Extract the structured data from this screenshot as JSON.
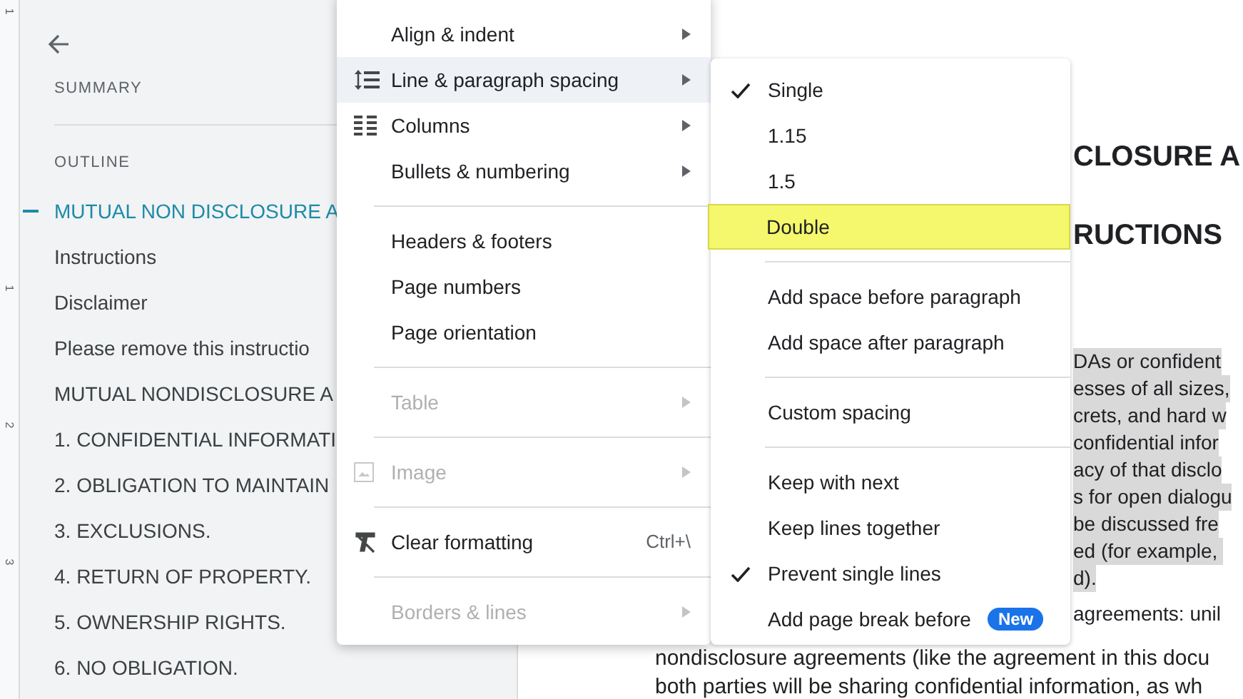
{
  "ruler": {
    "labels": [
      "1",
      "1",
      "2",
      "3"
    ]
  },
  "sidebar": {
    "summary_label": "SUMMARY",
    "outline_label": "OUTLINE",
    "items": [
      {
        "label": "MUTUAL NON DISCLOSURE A",
        "selected": true
      },
      {
        "label": "Instructions",
        "selected": false
      },
      {
        "label": "Disclaimer",
        "selected": false
      },
      {
        "label": "Please remove this instructio",
        "selected": false
      },
      {
        "label": "MUTUAL NONDISCLOSURE A",
        "selected": false
      },
      {
        "label": "1. CONFIDENTIAL INFORMATI",
        "selected": false
      },
      {
        "label": "2. OBLIGATION TO MAINTAIN",
        "selected": false
      },
      {
        "label": "3. EXCLUSIONS.",
        "selected": false
      },
      {
        "label": "4. RETURN OF PROPERTY.",
        "selected": false
      },
      {
        "label": "5. OWNERSHIP RIGHTS.",
        "selected": false
      },
      {
        "label": "6. NO OBLIGATION.",
        "selected": false
      }
    ]
  },
  "document": {
    "headings": [
      "CLOSURE A",
      "RUCTIONS"
    ],
    "highlighted_lines": [
      "DAs or confident",
      "esses of all sizes,",
      "crets, and hard w",
      "confidential infor",
      "acy of that disclo",
      "s for open dialogu",
      "be discussed fre",
      "ed (for example, ",
      "d)."
    ],
    "side_line": "agreements: unil",
    "lines": [
      "nondisclosure agreements (like the agreement in this docu",
      "both parties will be sharing confidential information, as wh"
    ]
  },
  "format_menu": {
    "items": [
      {
        "kind": "item",
        "label": "Align & indent",
        "submenu": true,
        "disabled": false,
        "selected": false
      },
      {
        "kind": "spacing",
        "label": "Line & paragraph spacing",
        "submenu": true,
        "disabled": false,
        "selected": true
      },
      {
        "kind": "columns",
        "label": "Columns",
        "submenu": true,
        "disabled": false,
        "selected": false
      },
      {
        "kind": "item",
        "label": "Bullets & numbering",
        "submenu": true,
        "disabled": false,
        "selected": false
      },
      {
        "kind": "separator"
      },
      {
        "kind": "item",
        "label": "Headers & footers",
        "submenu": false,
        "disabled": false,
        "selected": false
      },
      {
        "kind": "item",
        "label": "Page numbers",
        "submenu": false,
        "disabled": false,
        "selected": false
      },
      {
        "kind": "item",
        "label": "Page orientation",
        "submenu": false,
        "disabled": false,
        "selected": false
      },
      {
        "kind": "separator"
      },
      {
        "kind": "item",
        "label": "Table",
        "submenu": true,
        "disabled": true,
        "selected": false
      },
      {
        "kind": "separator"
      },
      {
        "kind": "image",
        "label": "Image",
        "submenu": true,
        "disabled": true,
        "selected": false
      },
      {
        "kind": "separator"
      },
      {
        "kind": "clear",
        "label": "Clear formatting",
        "submenu": false,
        "disabled": false,
        "selected": false,
        "shortcut": "Ctrl+\\"
      },
      {
        "kind": "separator"
      },
      {
        "kind": "item",
        "label": "Borders & lines",
        "submenu": true,
        "disabled": true,
        "selected": false
      }
    ]
  },
  "spacing_menu": {
    "items": [
      {
        "kind": "item",
        "label": "Single",
        "checked": true,
        "highlighted": false
      },
      {
        "kind": "item",
        "label": "1.15",
        "checked": false,
        "highlighted": false
      },
      {
        "kind": "item",
        "label": "1.5",
        "checked": false,
        "highlighted": false
      },
      {
        "kind": "item",
        "label": "Double",
        "checked": false,
        "highlighted": true
      },
      {
        "kind": "separator"
      },
      {
        "kind": "item",
        "label": "Add space before paragraph",
        "checked": false,
        "highlighted": false
      },
      {
        "kind": "item",
        "label": "Add space after paragraph",
        "checked": false,
        "highlighted": false
      },
      {
        "kind": "separator"
      },
      {
        "kind": "item",
        "label": "Custom spacing",
        "checked": false,
        "highlighted": false
      },
      {
        "kind": "separator"
      },
      {
        "kind": "item",
        "label": "Keep with next",
        "checked": false,
        "highlighted": false
      },
      {
        "kind": "item",
        "label": "Keep lines together",
        "checked": false,
        "highlighted": false
      },
      {
        "kind": "item",
        "label": "Prevent single lines",
        "checked": true,
        "highlighted": false
      },
      {
        "kind": "item",
        "label": "Add page break before",
        "checked": false,
        "highlighted": false,
        "badge": "New"
      }
    ]
  }
}
